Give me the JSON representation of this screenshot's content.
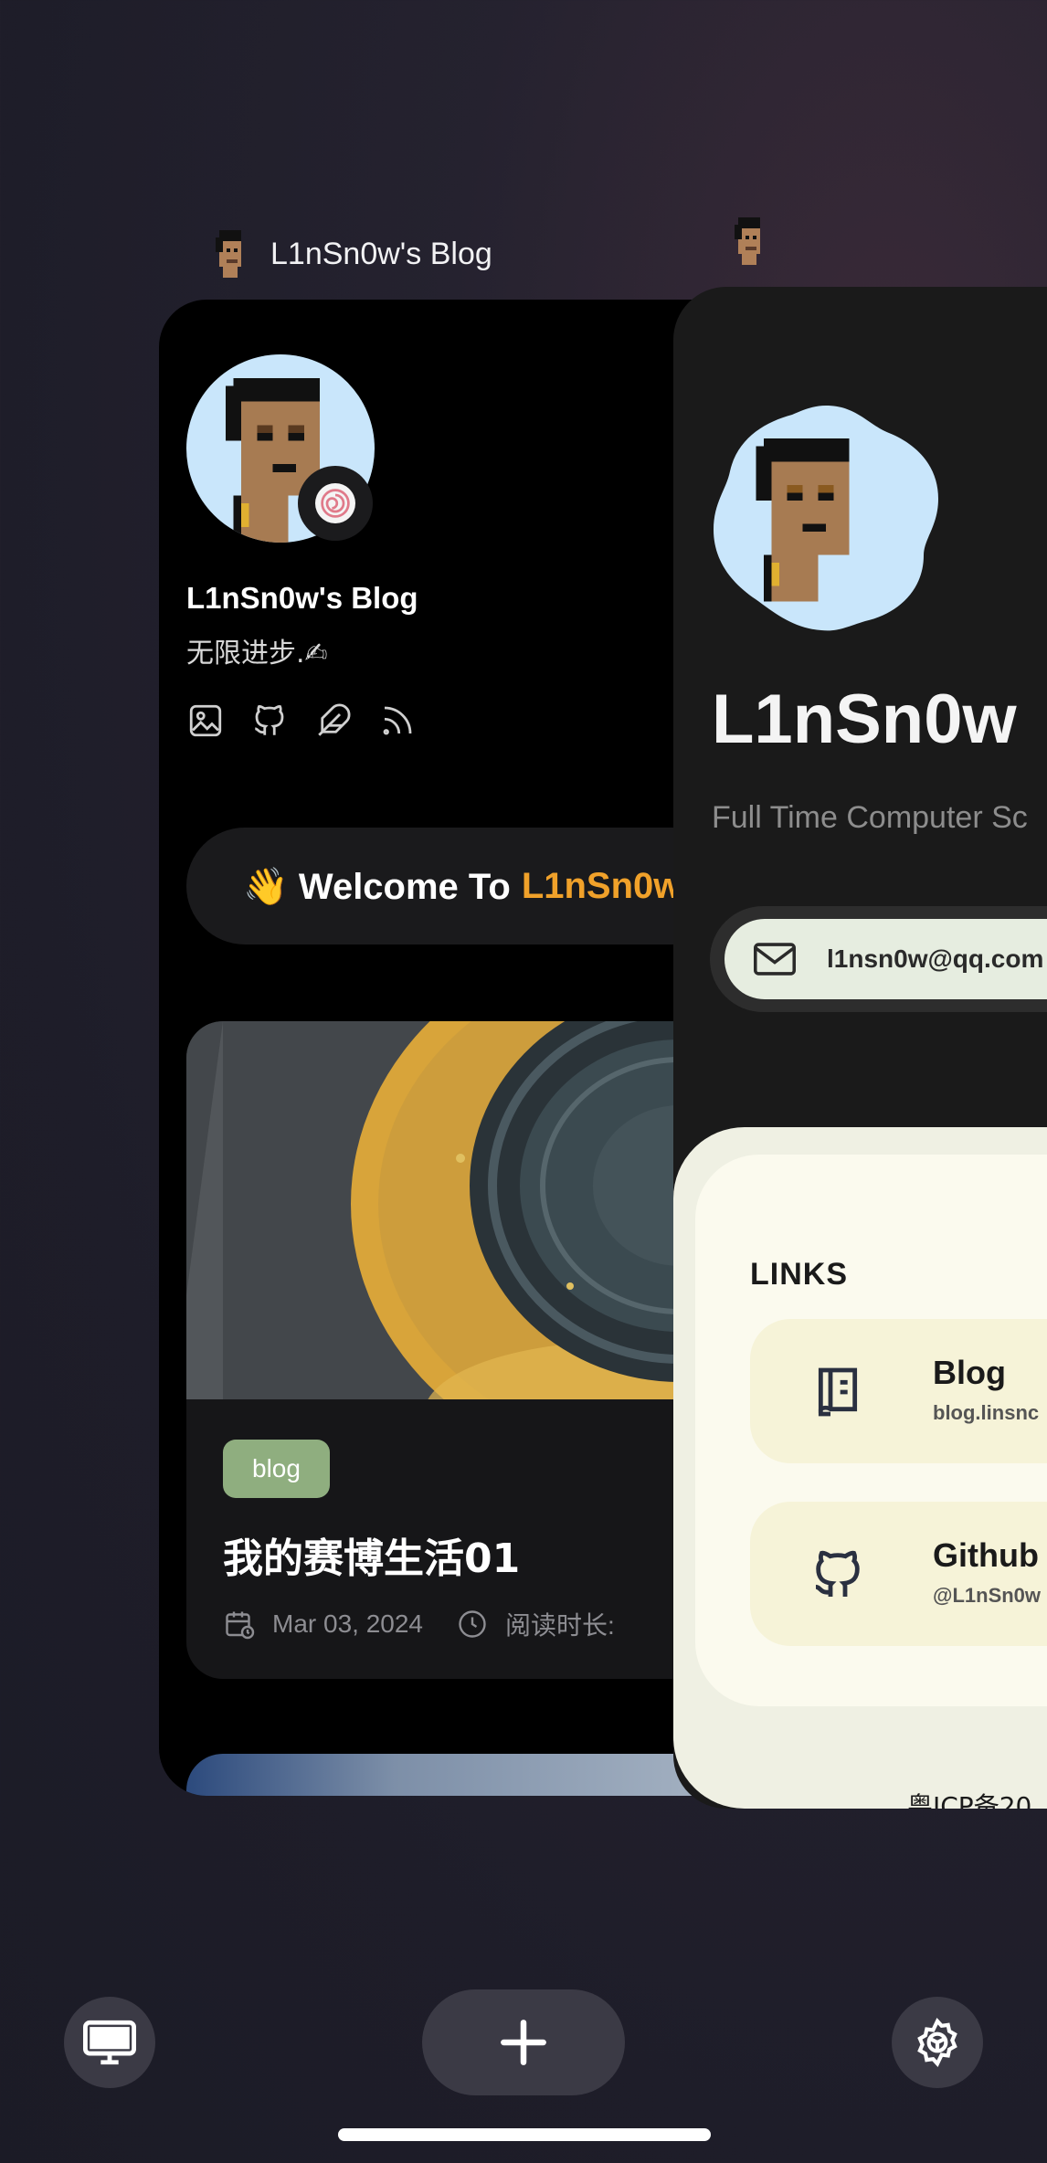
{
  "left_card": {
    "label": "L1nSn0w's Blog",
    "blog_title": "L1nSn0w's Blog",
    "motto": "无限进步.✍",
    "social_icons": [
      "image-icon",
      "github-icon",
      "feather-icon",
      "rss-icon"
    ],
    "welcome_prefix": "👋 Welcome To",
    "welcome_highlight": "L1nSn0w",
    "post": {
      "tag": "blog",
      "title": "我的赛博生活01",
      "date": "Mar 03, 2024",
      "reading_label": "阅读时长: "
    }
  },
  "right_card": {
    "name": "L1nSn0w",
    "subtitle": "Full Time Computer Sc",
    "email": "l1nsn0w@qq.com",
    "links_heading": "LINKS",
    "links": [
      {
        "title": "Blog",
        "sub": "blog.linsnc",
        "icon": "book-icon"
      },
      {
        "title": "Github",
        "sub": "@L1nSn0w",
        "icon": "github-icon"
      }
    ],
    "icp": "粤ICP备20"
  },
  "bottom_bar": {
    "icons": [
      "desktop-icon",
      "plus-icon",
      "settings-icon"
    ]
  },
  "colors": {
    "accent_orange": "#f0a12a",
    "tag_green": "#8fae7f",
    "avatar_bg": "#c9e6fb",
    "links_card": "#fbfaee"
  }
}
